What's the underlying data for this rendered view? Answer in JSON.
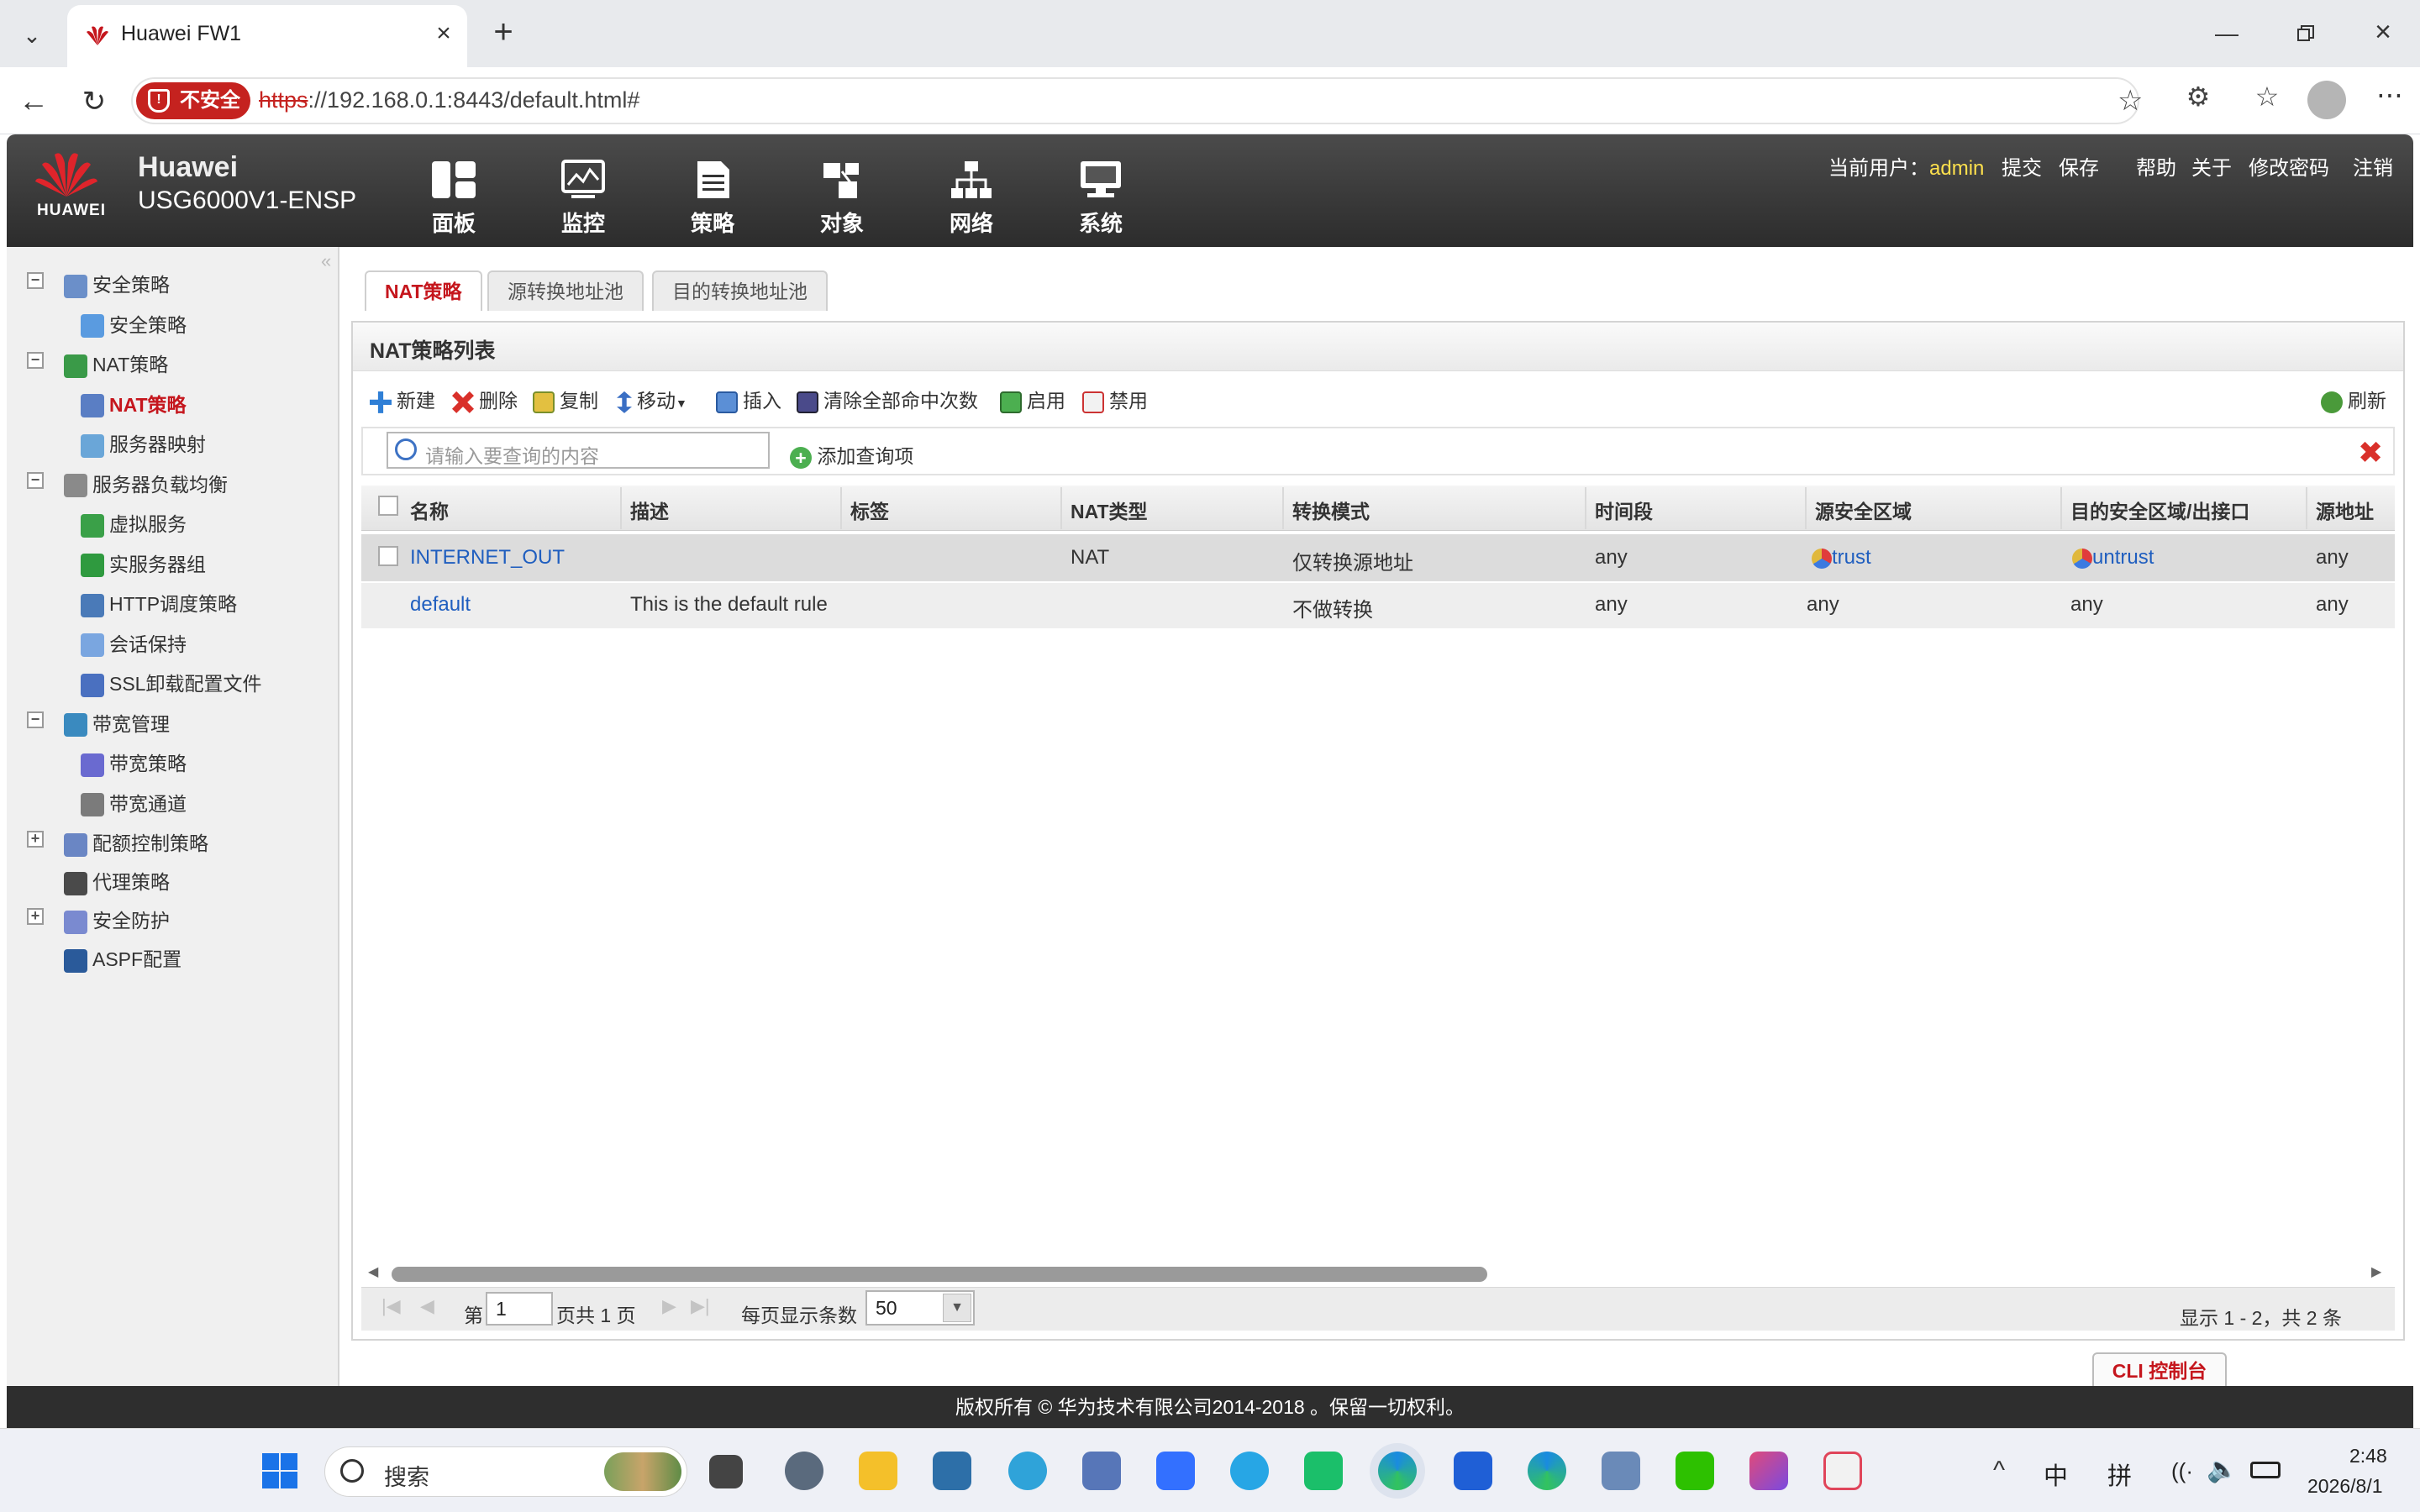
{
  "browser": {
    "tab_title": "Huawei FW1",
    "security_label": "不安全",
    "url_scheme": "https",
    "url_rest": "://192.168.0.1:8443/default.html#"
  },
  "app": {
    "brand": "HUAWEI",
    "vendor": "Huawei",
    "model": "USG6000V1-ENSP",
    "nav": [
      "面板",
      "监控",
      "策略",
      "对象",
      "网络",
      "系统"
    ],
    "user_label": "当前用户：",
    "user_name": "admin",
    "actions": [
      "提交",
      "保存",
      "帮助",
      "关于",
      "修改密码",
      "注销"
    ],
    "colors": {
      "accent_red": "#c5161d",
      "user_yellow": "#ffe14d",
      "link_blue": "#1f5ebf"
    }
  },
  "sidebar": {
    "items": [
      {
        "label": "安全策略",
        "level": 0,
        "expander": "−"
      },
      {
        "label": "安全策略",
        "level": 1
      },
      {
        "label": "NAT策略",
        "level": 0,
        "expander": "−"
      },
      {
        "label": "NAT策略",
        "level": 1,
        "selected": true
      },
      {
        "label": "服务器映射",
        "level": 1
      },
      {
        "label": "服务器负载均衡",
        "level": 0,
        "expander": "−"
      },
      {
        "label": "虚拟服务",
        "level": 1
      },
      {
        "label": "实服务器组",
        "level": 1
      },
      {
        "label": "HTTP调度策略",
        "level": 1
      },
      {
        "label": "会话保持",
        "level": 1
      },
      {
        "label": "SSL卸载配置文件",
        "level": 1
      },
      {
        "label": "带宽管理",
        "level": 0,
        "expander": "−"
      },
      {
        "label": "带宽策略",
        "level": 1
      },
      {
        "label": "带宽通道",
        "level": 1
      },
      {
        "label": "配额控制策略",
        "level": 0,
        "expander": "+"
      },
      {
        "label": "代理策略",
        "level": 0
      },
      {
        "label": "安全防护",
        "level": 0,
        "expander": "+"
      },
      {
        "label": "ASPF配置",
        "level": 0
      }
    ]
  },
  "tabs": [
    "NAT策略",
    "源转换地址池",
    "目的转换地址池"
  ],
  "panel": {
    "title": "NAT策略列表",
    "toolbar": [
      "新建",
      "删除",
      "复制",
      "移动",
      "插入",
      "清除全部命中次数",
      "启用",
      "禁用"
    ],
    "refresh": "刷新",
    "search_placeholder": "请输入要查询的内容",
    "add_query": "添加查询项"
  },
  "table": {
    "columns": [
      "名称",
      "描述",
      "标签",
      "NAT类型",
      "转换模式",
      "时间段",
      "源安全区域",
      "目的安全区域/出接口",
      "源地址"
    ],
    "rows": [
      {
        "name": "INTERNET_OUT",
        "desc": "",
        "tag": "",
        "nat_type": "NAT",
        "mode": "仅转换源地址",
        "time": "any",
        "src_zone": "trust",
        "dst_zone": "untrust",
        "src_addr": "any"
      },
      {
        "name": "default",
        "desc": "This is the default rule",
        "tag": "",
        "nat_type": "",
        "mode": "不做转换",
        "time": "any",
        "src_zone": "any",
        "dst_zone": "any",
        "src_addr": "any"
      }
    ]
  },
  "pager": {
    "page_prefix": "第",
    "page_value": "1",
    "page_suffix": "页共 1 页",
    "per_page_label": "每页显示条数",
    "per_page_value": "50",
    "summary": "显示 1 - 2，共 2 条"
  },
  "cli_button": "CLI 控制台",
  "footer": "版权所有 © 华为技术有限公司2014-2018 。保留一切权利。",
  "taskbar": {
    "search_placeholder": "搜索",
    "ime1": "中",
    "ime2": "拼",
    "time": "2:48",
    "date": "2026/8/1"
  }
}
